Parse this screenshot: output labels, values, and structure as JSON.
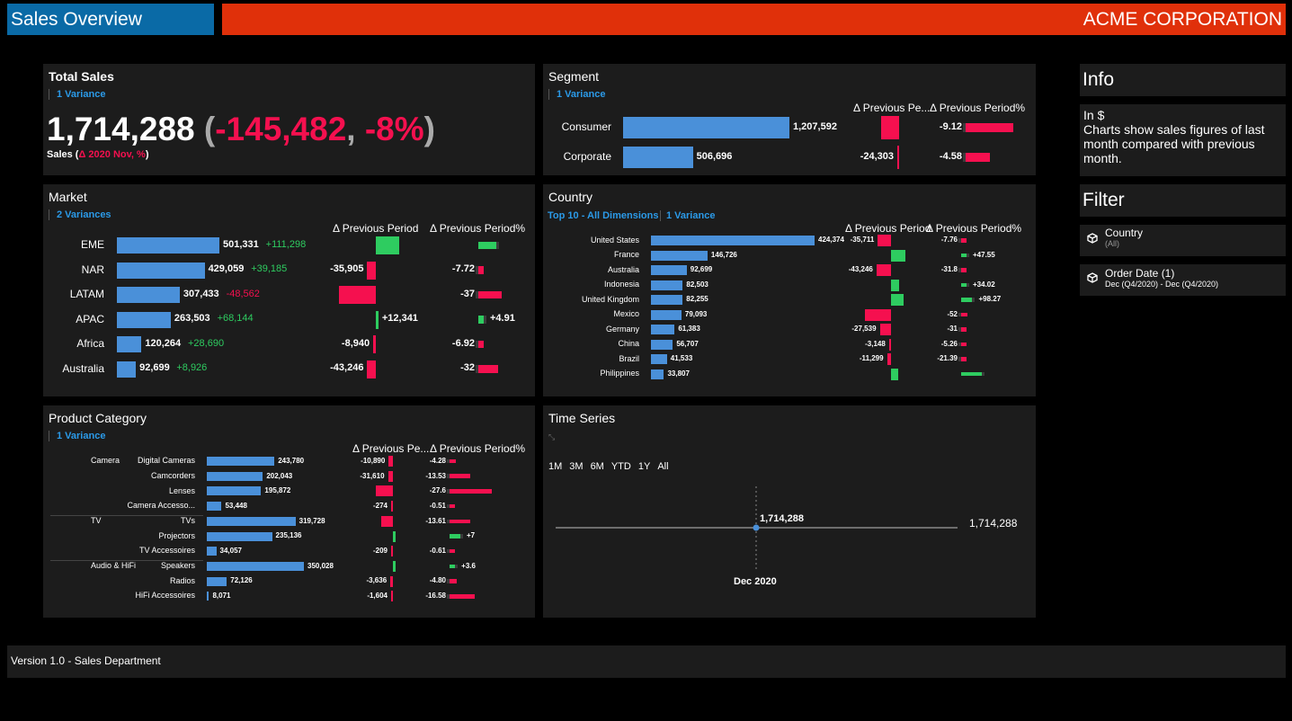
{
  "header": {
    "title": "Sales Overview",
    "company": "ACME CORPORATION"
  },
  "total_sales": {
    "title": "Total Sales",
    "variance_link": "1 Variance",
    "value": "1,714,288",
    "open_paren": "(",
    "delta": "-145,482",
    "comma": ",",
    "delta_pct": "-8%",
    "close_paren": ")",
    "caption_prefix": "Sales (",
    "caption_delta": "Δ 2020 Nov, %",
    "caption_suffix": ")"
  },
  "segment": {
    "title": "Segment",
    "variance_link": "1 Variance",
    "col_prev": "Δ Previous Pe...",
    "col_pct": "Δ Previous Period%",
    "max": 1207592,
    "dmax": 24303,
    "pmax": 10,
    "rows": [
      {
        "name": "Consumer",
        "value": 1207592,
        "value_text": "1,207,592",
        "delta": -24303,
        "delta_text": "",
        "pct": -9.12,
        "pct_text": "-9.12"
      },
      {
        "name": "Corporate",
        "value": 506696,
        "value_text": "506,696",
        "delta": -2000,
        "delta_text": "-24,303",
        "pct": -4.58,
        "pct_text": "-4.58"
      }
    ]
  },
  "market": {
    "title": "Market",
    "variance_link": "2 Variances",
    "col_prev": "Δ Previous Period",
    "col_pct": "Δ Previous Period%",
    "max": 501331,
    "dmax": 45000,
    "pmax": 40,
    "rows": [
      {
        "name": "EME",
        "value": 501331,
        "value_text": "501,331",
        "var_text": "+111,298",
        "var_color": "#2ecc60",
        "delta": 27000,
        "delta_text": "",
        "pct": 28,
        "pct_text": ""
      },
      {
        "name": "NAR",
        "value": 429059,
        "value_text": "429,059",
        "var_text": "+39,185",
        "var_color": "#2ecc60",
        "delta": -10000,
        "delta_text": "-35,905",
        "pct": -7.72,
        "pct_text": "-7.72"
      },
      {
        "name": "LATAM",
        "value": 307433,
        "value_text": "307,433",
        "var_text": "-48,562",
        "var_color": "#f5104f",
        "delta": -43000,
        "delta_text": "",
        "pct": -37,
        "pct_text": "-37"
      },
      {
        "name": "APAC",
        "value": 263503,
        "value_text": "263,503",
        "var_text": "+68,144",
        "var_color": "#2ecc60",
        "delta": 3000,
        "delta_text": "+12,341",
        "pct": 4.91,
        "pct_text": "+4.91"
      },
      {
        "name": "Africa",
        "value": 120264,
        "value_text": "120,264",
        "var_text": "+28,690",
        "var_color": "#2ecc60",
        "delta": -3000,
        "delta_text": "-8,940",
        "pct": -6.92,
        "pct_text": "-6.92"
      },
      {
        "name": "Australia",
        "value": 92699,
        "value_text": "92,699",
        "var_text": "+8,926",
        "var_color": "#2ecc60",
        "delta": -10000,
        "delta_text": "-43,246",
        "pct": -32,
        "pct_text": "-32"
      }
    ]
  },
  "country": {
    "title": "Country",
    "filter_link": "Top 10 - All Dimensions",
    "variance_link": "1 Variance",
    "col_prev": "Δ Previous Period",
    "col_pct": "Δ Previous Period%",
    "max": 424374,
    "dmax": 45000,
    "pmax": 100,
    "rows": [
      {
        "name": "United States",
        "value": 424374,
        "value_text": "424,374",
        "delta": -20000,
        "delta_text": "-35,711",
        "pct": -7.76,
        "pct_text": "-7.76"
      },
      {
        "name": "France",
        "value": 146726,
        "value_text": "146,726",
        "delta": 22000,
        "delta_text": "",
        "pct": 12,
        "pct_text": "+47.55"
      },
      {
        "name": "Australia",
        "value": 92699,
        "value_text": "92,699",
        "delta": -22000,
        "delta_text": "-43,246",
        "pct": -8,
        "pct_text": "-31.8"
      },
      {
        "name": "Indonesia",
        "value": 82503,
        "value_text": "82,503",
        "delta": 12000,
        "delta_text": "",
        "pct": 9,
        "pct_text": "+34.02"
      },
      {
        "name": "United Kingdom",
        "value": 82255,
        "value_text": "82,255",
        "delta": 19000,
        "delta_text": "",
        "pct": 26,
        "pct_text": "+98.27"
      },
      {
        "name": "Mexico",
        "value": 79093,
        "value_text": "79,093",
        "delta": -40000,
        "delta_text": "",
        "pct": -14,
        "pct_text": "-52"
      },
      {
        "name": "Germany",
        "value": 61383,
        "value_text": "61,383",
        "delta": -17000,
        "delta_text": "-27,539",
        "pct": -8,
        "pct_text": "-31"
      },
      {
        "name": "China",
        "value": 56707,
        "value_text": "56,707",
        "delta": -3000,
        "delta_text": "-3,148",
        "pct": -2,
        "pct_text": "-5.26"
      },
      {
        "name": "Brazil",
        "value": 41533,
        "value_text": "41,533",
        "delta": -6000,
        "delta_text": "-11,299",
        "pct": -6,
        "pct_text": "-21.39"
      },
      {
        "name": "Philippines",
        "value": 33807,
        "value_text": "33,807",
        "delta": 11000,
        "delta_text": "",
        "pct": 48,
        "pct_text": ""
      }
    ]
  },
  "product": {
    "title": "Product Category",
    "variance_link": "1 Variance",
    "col_prev": "Δ Previous Pe...",
    "col_pct": "Δ Previous Period%",
    "max": 350028,
    "dmax": 32000,
    "pmax": 28,
    "rows": [
      {
        "group": "Camera",
        "name": "Digital Cameras",
        "value": 243780,
        "value_text": "243,780",
        "delta": -6000,
        "delta_text": "-10,890",
        "pct": -4.28,
        "pct_text": "-4.28"
      },
      {
        "group": "",
        "name": "Camcorders",
        "value": 202043,
        "value_text": "202,043",
        "delta": -7000,
        "delta_text": "-31,610",
        "pct": -13.53,
        "pct_text": "-13.53"
      },
      {
        "group": "",
        "name": "Lenses",
        "value": 195872,
        "value_text": "195,872",
        "delta": -24000,
        "delta_text": "",
        "pct": -27.6,
        "pct_text": "-27.6"
      },
      {
        "group": "",
        "name": "Camera Accesso...",
        "value": 53448,
        "value_text": "53,448",
        "delta": -274,
        "delta_text": "-274",
        "pct": -0.51,
        "pct_text": "-0.51"
      },
      {
        "group": "TV",
        "name": "TVs",
        "value": 319728,
        "value_text": "319,728",
        "delta": -17000,
        "delta_text": "",
        "pct": -13.61,
        "pct_text": "-13.61"
      },
      {
        "group": "",
        "name": "Projectors",
        "value": 235136,
        "value_text": "235,136",
        "delta": 4000,
        "delta_text": "",
        "pct": 7,
        "pct_text": "+7"
      },
      {
        "group": "",
        "name": "TV Accessoires",
        "value": 34057,
        "value_text": "34,057",
        "delta": -209,
        "delta_text": "-209",
        "pct": -0.61,
        "pct_text": "-0.61"
      },
      {
        "group": "Audio & HiFi",
        "name": "Speakers",
        "value": 350028,
        "value_text": "350,028",
        "delta": 4000,
        "delta_text": "",
        "pct": 3.6,
        "pct_text": "+3.6"
      },
      {
        "group": "",
        "name": "Radios",
        "value": 72126,
        "value_text": "72,126",
        "delta": -3636,
        "delta_text": "-3,636",
        "pct": -4.8,
        "pct_text": "-4.80"
      },
      {
        "group": "",
        "name": "HiFi Accessoires",
        "value": 8071,
        "value_text": "8,071",
        "delta": -1604,
        "delta_text": "-1,604",
        "pct": -16.58,
        "pct_text": "-16.58"
      }
    ]
  },
  "time_series": {
    "title": "Time Series",
    "ranges": [
      "1M",
      "3M",
      "6M",
      "YTD",
      "1Y",
      "All"
    ],
    "point_label": "1,714,288",
    "end_label": "1,714,288",
    "x_label": "Dec 2020"
  },
  "info": {
    "title": "Info",
    "unit": "In $",
    "text": "Charts show sales figures of last month compared with previous month."
  },
  "filter": {
    "title": "Filter",
    "items": [
      {
        "name": "Country",
        "value": "(All)"
      },
      {
        "name": "Order Date (1)",
        "value": "Dec (Q4/2020) - Dec (Q4/2020)"
      }
    ]
  },
  "footer": {
    "text": "Version 1.0 - Sales Department"
  },
  "colors": {
    "positive": "#2ecc60",
    "negative": "#f5104f",
    "bar": "#4a90d9",
    "link": "#2b9ae8"
  }
}
